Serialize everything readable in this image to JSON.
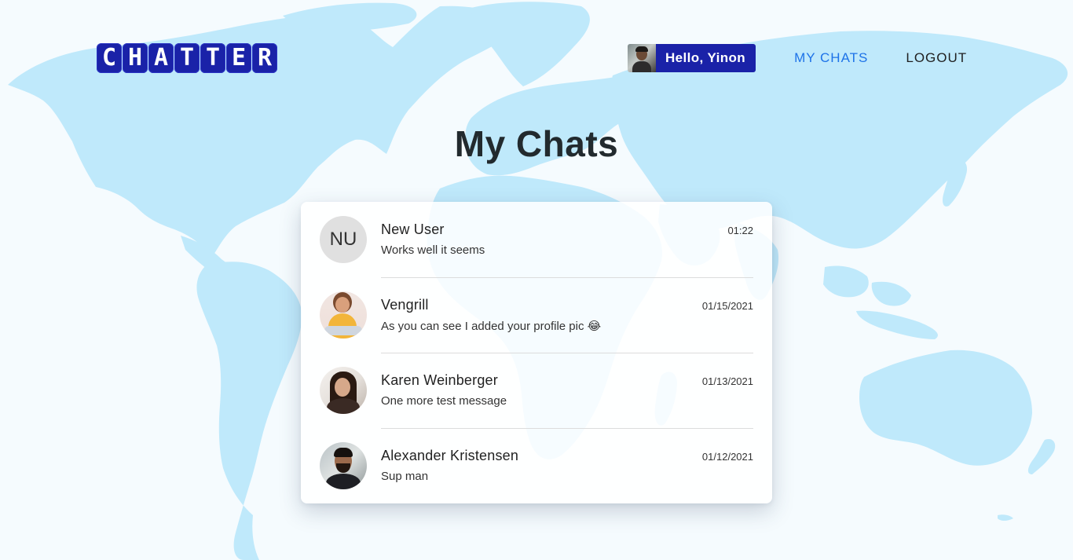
{
  "app": {
    "logo_letters": [
      "C",
      "H",
      "A",
      "T",
      "T",
      "E",
      "R"
    ]
  },
  "nav": {
    "greeting": "Hello, Yinon",
    "my_chats": "MY CHATS",
    "logout": "LOGOUT"
  },
  "page": {
    "title": "My Chats"
  },
  "chats": [
    {
      "name": "New User",
      "initials": "NU",
      "message": "Works well it seems",
      "time": "01:22"
    },
    {
      "name": "Vengrill",
      "message": "As you can see I added your profile pic 😂",
      "time": "01/15/2021"
    },
    {
      "name": "Karen Weinberger",
      "message": "One more test message",
      "time": "01/13/2021"
    },
    {
      "name": "Alexander Kristensen",
      "message": "Sup man",
      "time": "01/12/2021"
    }
  ],
  "colors": {
    "brand": "#1a22a8",
    "active_link": "#1e73e8",
    "map_land": "#bfe9fb",
    "background": "#f5fbfe"
  }
}
